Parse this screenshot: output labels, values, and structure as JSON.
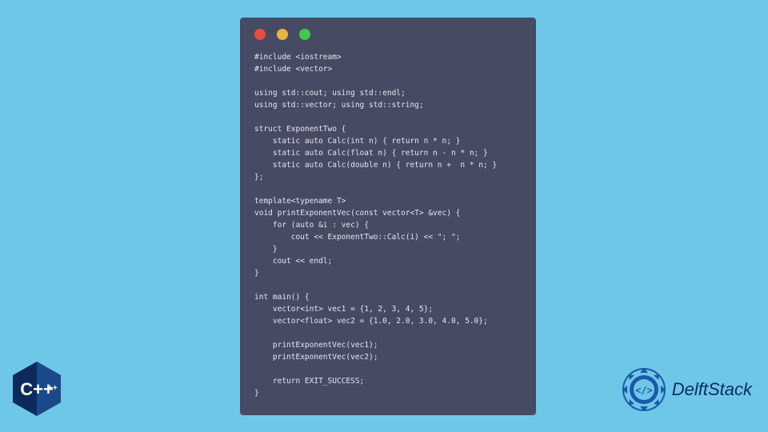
{
  "window": {
    "dots": [
      "red",
      "yellow",
      "green"
    ]
  },
  "code_lines": [
    "#include <iostream>",
    "#include <vector>",
    "",
    "using std::cout; using std::endl;",
    "using std::vector; using std::string;",
    "",
    "struct ExponentTwo {",
    "    static auto Calc(int n) { return n * n; }",
    "    static auto Calc(float n) { return n - n * n; }",
    "    static auto Calc(double n) { return n +  n * n; }",
    "};",
    "",
    "template<typename T>",
    "void printExponentVec(const vector<T> &vec) {",
    "    for (auto &i : vec) {",
    "        cout << ExponentTwo::Calc(i) << \"; \";",
    "    }",
    "    cout << endl;",
    "}",
    "",
    "int main() {",
    "    vector<int> vec1 = {1, 2, 3, 4, 5};",
    "    vector<float> vec2 = {1.0, 2.0, 3.0, 4.0, 5.0};",
    "",
    "    printExponentVec(vec1);",
    "    printExponentVec(vec2);",
    "",
    "    return EXIT_SUCCESS;",
    "}"
  ],
  "badges": {
    "cpp_label": "C++",
    "brand_name": "DelftStack"
  }
}
